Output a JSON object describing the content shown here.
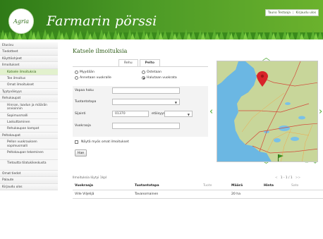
{
  "header": {
    "logo_text": "Agria",
    "site_title": "Farmarin pörssi",
    "user_name": "Tauno Testaaja",
    "logout": "Kirjaudu ulos"
  },
  "sidebar": {
    "items": [
      {
        "label": "Etusivu",
        "level": 0
      },
      {
        "label": "Tiedotteet",
        "level": 0
      },
      {
        "label": "Käyttöohjeet",
        "level": 0
      },
      {
        "label": "Ilmoitukset",
        "level": 0
      },
      {
        "label": "Katsele ilmoituksia",
        "level": 1,
        "active": true
      },
      {
        "label": "Tee ilmoitus",
        "level": 1
      },
      {
        "label": "Omat ilmoitukset",
        "level": 1
      },
      {
        "label": "Tyytyväisyys",
        "level": 0
      },
      {
        "label": "Rehukaupat",
        "level": 0
      },
      {
        "label": "Hinnan, laadun ja määrän arvioinnin",
        "level": 1,
        "tall": true
      },
      {
        "label": "Sopimusmalli",
        "level": 1
      },
      {
        "label": "Laskuttaminen",
        "level": 1
      },
      {
        "label": "Rehukaupan kampat",
        "level": 1
      },
      {
        "label": "Peltokaupat",
        "level": 0
      },
      {
        "label": "Pellon vuokrauksen sopimusmalli",
        "level": 1,
        "tall": true
      },
      {
        "label": "Peltokaupan tekeminen",
        "level": 1,
        "tall": true
      },
      {
        "label": "Tietoutta tilatukikeskusta",
        "level": 1,
        "tall": true
      },
      {
        "label": "Omat tiedot",
        "level": 0
      },
      {
        "label": "Palaute",
        "level": 0
      },
      {
        "label": "Kirjaudu ulos",
        "level": 0
      }
    ]
  },
  "main": {
    "page_title": "Katsele ilmoituksia",
    "tabs": [
      {
        "label": "Rehu",
        "active": false
      },
      {
        "label": "Pelto",
        "active": true
      }
    ],
    "radios": [
      {
        "label": "Myydään",
        "checked": false
      },
      {
        "label": "Ostetaan",
        "checked": false
      },
      {
        "label": "Annetaan vuokralle",
        "checked": false
      },
      {
        "label": "Halutaan vuokrata",
        "checked": true
      }
    ],
    "form": {
      "free_text_label": "Vapaa haku",
      "free_text_value": "",
      "product_label": "Tuotantotapa",
      "product_value": "",
      "location_label": "Sijainti",
      "location_value": "01370",
      "distance_label": "etäisyys",
      "distance_value": "",
      "rent_label": "Vuokraaja",
      "rent_value": "",
      "show_own_label": "Näytä myös omat ilmoitukset",
      "search_button": "Hae"
    },
    "map": {
      "controls": {
        "up": "^",
        "down": "v",
        "left": "<",
        "right": ">",
        "zoom_in": "+",
        "zoom_out": "−"
      }
    },
    "results": {
      "count_text": "Ilmoituksia löytyi 1kpl",
      "pager": {
        "prev": "<<",
        "prev_one": "<",
        "current": "1 - 1 / 1",
        "next": ">>"
      },
      "columns": [
        "Vuokraaja",
        "Tuotantotapa",
        "Tuote",
        "Määrä",
        "Hinta",
        "Sato"
      ],
      "rows": [
        {
          "vuokraaja": "Ville Viljelijä",
          "tuotantotapa": "Tavanomainen",
          "tuote": "",
          "maara": "20 ha",
          "hinta": "",
          "sato": ""
        }
      ]
    }
  },
  "colors": {
    "header_green": "#3e8a1f",
    "accent_green": "#4aa52a",
    "active_nav": "#e2f1cd",
    "map_sea": "#6bb7e3",
    "map_land": "#c8d69a",
    "marker_red": "#d8232a"
  }
}
